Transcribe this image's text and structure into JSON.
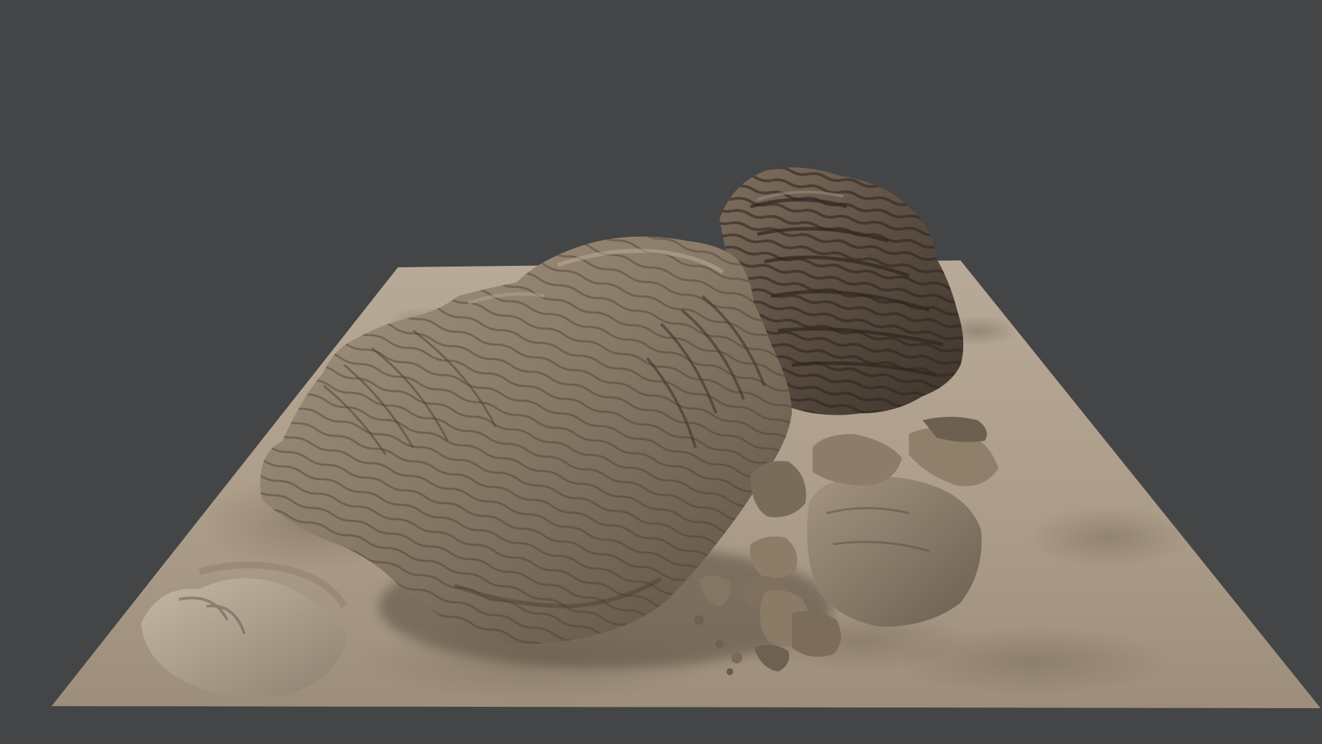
{
  "viewport": {
    "background_color": "#444546"
  },
  "scene": {
    "subject": "rocks-on-sand-terrain-3d-render",
    "colors": {
      "sand_light": "#b3a493",
      "sand_mid": "#a4947f",
      "sand_dark": "#857663",
      "rock_light": "#9b8c79",
      "rock_mid": "#7c6d5c",
      "rock_dark": "#4f4338",
      "rock_back": "#5e5043",
      "shadow": "#3e342b"
    }
  }
}
